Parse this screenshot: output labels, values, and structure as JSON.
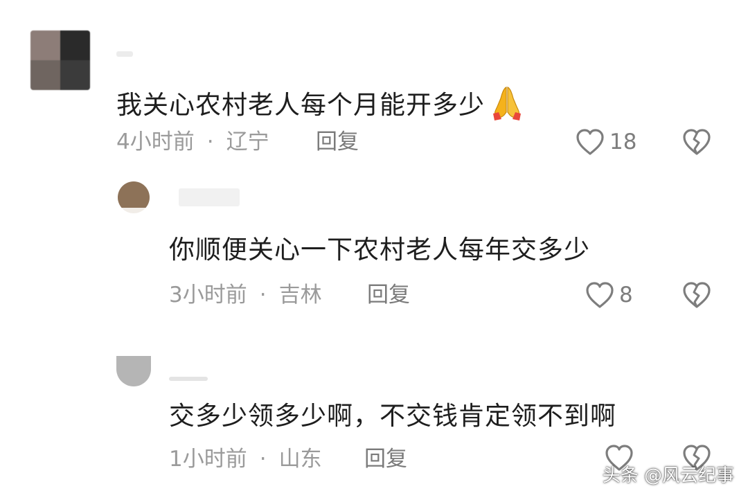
{
  "comments": [
    {
      "text": "我关心农村老人每个月能开多少",
      "emoji": "folded-hands-emoji",
      "time": "4小时前",
      "location": "辽宁",
      "reply_label": "回复",
      "likes": "18"
    },
    {
      "text": "你顺便关心一下农村老人每年交多少",
      "time": "3小时前",
      "location": "吉林",
      "reply_label": "回复",
      "likes": "8"
    },
    {
      "text": "交多少领多少啊，不交钱肯定领不到啊",
      "time": "1小时前",
      "location": "山东",
      "reply_label": "回复",
      "likes": ""
    }
  ],
  "separator": "·",
  "watermark": "头条 @风云纪事",
  "colors": {
    "text": "#1e1e1e",
    "meta": "#9a9a9a",
    "icon": "#7d7d7d",
    "emoji": "#f5b21b"
  }
}
